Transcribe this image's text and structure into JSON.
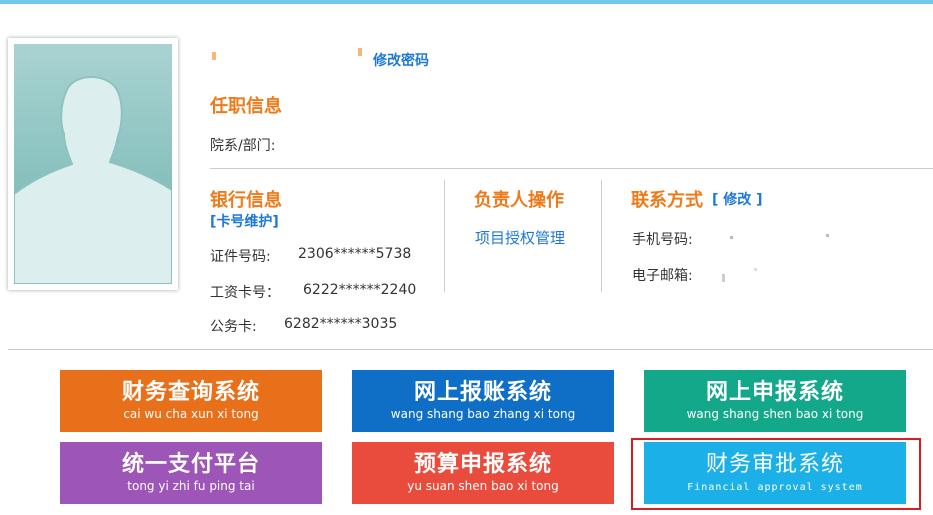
{
  "profile": {
    "change_password": "修改密码"
  },
  "employment": {
    "title": "任职信息",
    "department_label": "院系/部门:"
  },
  "bank": {
    "title": "银行信息",
    "card_maintain": "[卡号维护]",
    "id_label": "证件号码:",
    "id_value": "2306******5738",
    "salary_label": "工资卡号：",
    "salary_value": "6222******2240",
    "official_label": "公务卡:",
    "official_value": "6282******3035"
  },
  "manager": {
    "title": "负责人操作",
    "project_auth": "项目授权管理"
  },
  "contact": {
    "title": "联系方式",
    "edit": "[ 修改 ]",
    "phone_label": "手机号码:",
    "email_label": "电子邮箱:"
  },
  "tiles": [
    {
      "title": "财务查询系统",
      "subtitle": "cai wu cha xun xi tong",
      "color": "#e8701a"
    },
    {
      "title": "网上报账系统",
      "subtitle": "wang shang bao zhang xi tong",
      "color": "#0f6fc6"
    },
    {
      "title": "网上申报系统",
      "subtitle": "wang shang shen bao xi tong",
      "color": "#13a88a"
    },
    {
      "title": "统一支付平台",
      "subtitle": "tong yi zhi fu ping tai",
      "color": "#9e55b8"
    },
    {
      "title": "预算申报系统",
      "subtitle": "yu suan shen bao xi tong",
      "color": "#e94b3c"
    },
    {
      "title": "财务审批系统",
      "subtitle": "Financial approval system",
      "color": "#1bb0e8"
    }
  ],
  "colors": {
    "accent_orange": "#ef7a1a",
    "link_blue": "#1e78d7",
    "top_bar": "#72c8ec",
    "highlight_border": "#d42020"
  }
}
